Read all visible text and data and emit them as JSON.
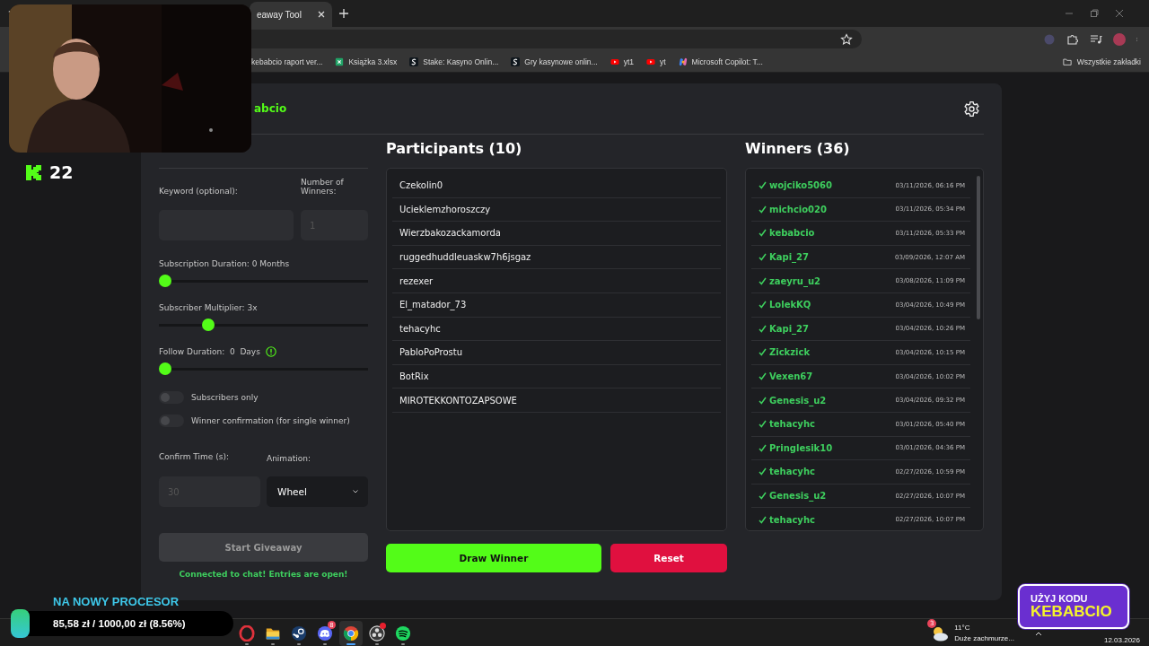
{
  "browser": {
    "tab_title": "eaway Tool",
    "bookmarks": [
      {
        "label": "kebabcio raport ver..."
      },
      {
        "label": "Książka 3.xlsx",
        "kind": "sheet"
      },
      {
        "label": "Stake: Kasyno Onlin...",
        "kind": "stake"
      },
      {
        "label": "Gry kasynowe onlin...",
        "kind": "stake"
      },
      {
        "label": "yt1",
        "kind": "youtube"
      },
      {
        "label": "yt",
        "kind": "youtube"
      },
      {
        "label": "Microsoft Copilot: T...",
        "kind": "copilot"
      }
    ],
    "all_bookmarks": "Wszystkie zakładki"
  },
  "app": {
    "brand": "abcio",
    "settings": {
      "keyword_label": "Keyword (optional):",
      "winners_label": "Number of Winners:",
      "winners_placeholder": "1",
      "sliders": [
        {
          "label": "Subscription Duration: 0 Months",
          "level": 0,
          "info": false
        },
        {
          "label": "Subscriber Multiplier: 3x",
          "level": 0.22,
          "info": false
        },
        {
          "label": "Follow Duration:  0  Days",
          "level": 0,
          "info": true
        }
      ],
      "toggles": [
        {
          "label": "Subscribers only",
          "on": false
        },
        {
          "label": "Winner confirmation (for single winner)",
          "on": false
        }
      ],
      "confirm_label": "Confirm Time (s):",
      "confirm_placeholder": "30",
      "animation_label": "Animation:",
      "animation_value": "Wheel",
      "start_button": {
        "label": "Start Giveaway",
        "disabled": true
      },
      "status": "Connected to chat! Entries are open!"
    },
    "participants_title": "Participants (10)",
    "participants": [
      "Czekolin0",
      "Ucieklemzhoroszczy",
      "Wierzbakozackamorda",
      "ruggedhuddleuaskw7h6jsgaz",
      "rezexer",
      "El_matador_73",
      "tehacyhc",
      "PabloPoProstu",
      "BotRix",
      "MIROTEKKONTOZAPSOWE"
    ],
    "draw_button": "Draw Winner",
    "reset_button": "Reset",
    "winners_title": "Winners (36)",
    "winners": [
      {
        "name": "wojciko5060",
        "time": "03/11/2026, 06:16 PM",
        "confirmed": true
      },
      {
        "name": "michcio020",
        "time": "03/11/2026, 05:34 PM",
        "confirmed": true
      },
      {
        "name": "kebabcio",
        "time": "03/11/2026, 05:33 PM",
        "confirmed": true
      },
      {
        "name": "Kapi_27",
        "time": "03/09/2026, 12:07 AM",
        "confirmed": true
      },
      {
        "name": "zaeyru_u2",
        "time": "03/08/2026, 11:09 PM",
        "confirmed": true
      },
      {
        "name": "LolekKQ",
        "time": "03/04/2026, 10:49 PM",
        "confirmed": true
      },
      {
        "name": "Kapi_27",
        "time": "03/04/2026, 10:26 PM",
        "confirmed": true
      },
      {
        "name": "Zickzick",
        "time": "03/04/2026, 10:15 PM",
        "confirmed": true
      },
      {
        "name": "Vexen67",
        "time": "03/04/2026, 10:02 PM",
        "confirmed": true
      },
      {
        "name": "Genesis_u2",
        "time": "03/04/2026, 09:32 PM",
        "confirmed": true
      },
      {
        "name": "tehacyhc",
        "time": "03/01/2026, 05:40 PM",
        "confirmed": true
      },
      {
        "name": "Pringlesik10",
        "time": "03/01/2026, 04:36 PM",
        "confirmed": true
      },
      {
        "name": "tehacyhc",
        "time": "02/27/2026, 10:59 PM",
        "confirmed": true
      },
      {
        "name": "Genesis_u2",
        "time": "02/27/2026, 10:07 PM",
        "confirmed": true
      },
      {
        "name": "tehacyhc",
        "time": "02/27/2026, 10:07 PM",
        "confirmed": true
      }
    ]
  },
  "stream_overlay": {
    "counter": "22",
    "goal": {
      "title": "NA NOWY PROCESOR",
      "amount": "85,58 zł / 1000,00 zł (8.56%)",
      "level": 0.0856
    },
    "promo": {
      "line_1": "UŻYJ KODU",
      "line_2": "KEBABCIO"
    }
  },
  "taskbar": {
    "apps": [
      {
        "kind": "opera",
        "active": false,
        "notification": false
      },
      {
        "kind": "folder",
        "active": false,
        "notification": false
      },
      {
        "kind": "steam",
        "active": false,
        "notification": false
      },
      {
        "kind": "discord",
        "active": false,
        "notification": false,
        "badge": "8"
      },
      {
        "kind": "chrome",
        "active": true,
        "notification": false
      },
      {
        "kind": "obs",
        "active": false,
        "notification": true
      },
      {
        "kind": "spotify",
        "active": false,
        "notification": false
      }
    ],
    "weather": {
      "badge": "3",
      "temperature": "11°C",
      "condition": "Duże zachmurze..."
    },
    "date": "12.03.2026"
  }
}
